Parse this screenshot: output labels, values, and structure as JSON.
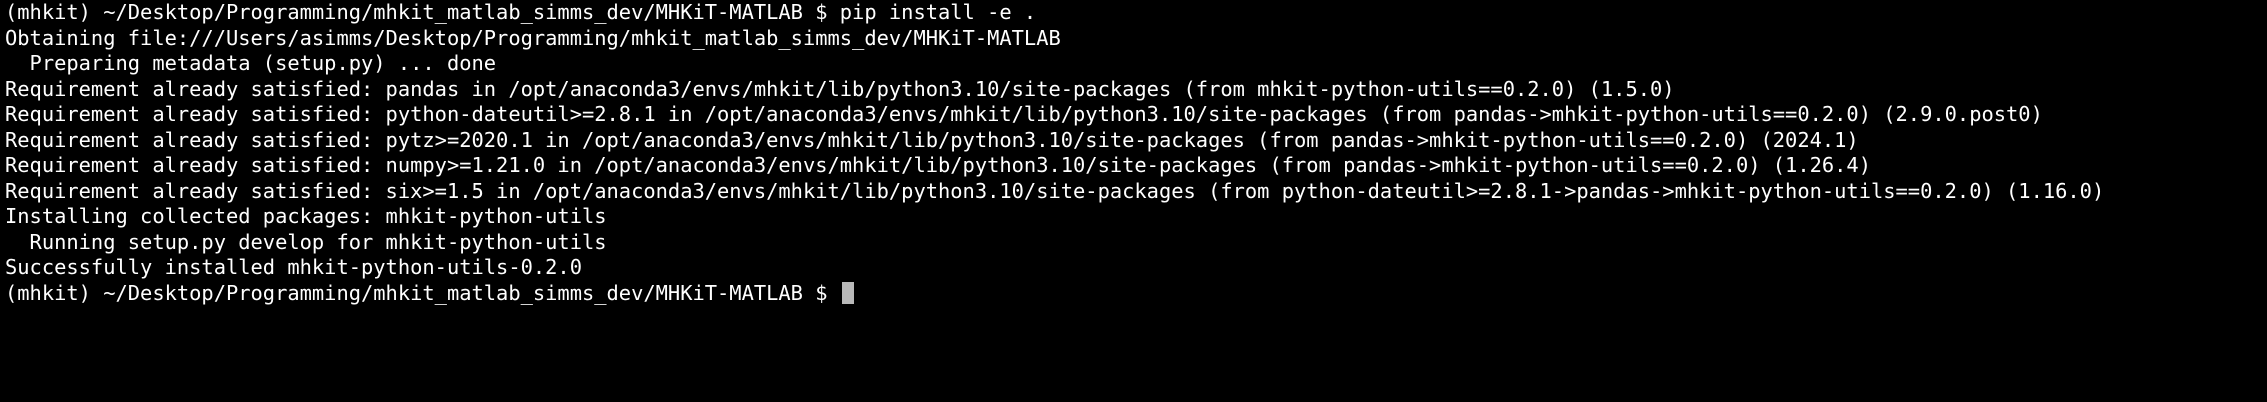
{
  "terminal": {
    "background": "#000000",
    "foreground": "#ffffff",
    "cursor_color": "#b9b9b9",
    "lines": [
      "(mhkit) ~/Desktop/Programming/mhkit_matlab_simms_dev/MHKiT-MATLAB $ pip install -e .",
      "Obtaining file:///Users/asimms/Desktop/Programming/mhkit_matlab_simms_dev/MHKiT-MATLAB",
      "  Preparing metadata (setup.py) ... done",
      "Requirement already satisfied: pandas in /opt/anaconda3/envs/mhkit/lib/python3.10/site-packages (from mhkit-python-utils==0.2.0) (1.5.0)",
      "Requirement already satisfied: python-dateutil>=2.8.1 in /opt/anaconda3/envs/mhkit/lib/python3.10/site-packages (from pandas->mhkit-python-utils==0.2.0) (2.9.0.post0)",
      "Requirement already satisfied: pytz>=2020.1 in /opt/anaconda3/envs/mhkit/lib/python3.10/site-packages (from pandas->mhkit-python-utils==0.2.0) (2024.1)",
      "Requirement already satisfied: numpy>=1.21.0 in /opt/anaconda3/envs/mhkit/lib/python3.10/site-packages (from pandas->mhkit-python-utils==0.2.0) (1.26.4)",
      "Requirement already satisfied: six>=1.5 in /opt/anaconda3/envs/mhkit/lib/python3.10/site-packages (from python-dateutil>=2.8.1->pandas->mhkit-python-utils==0.2.0) (1.16.0)",
      "Installing collected packages: mhkit-python-utils",
      "  Running setup.py develop for mhkit-python-utils",
      "Successfully installed mhkit-python-utils-0.2.0"
    ],
    "prompt": "(mhkit) ~/Desktop/Programming/mhkit_matlab_simms_dev/MHKiT-MATLAB $ "
  }
}
